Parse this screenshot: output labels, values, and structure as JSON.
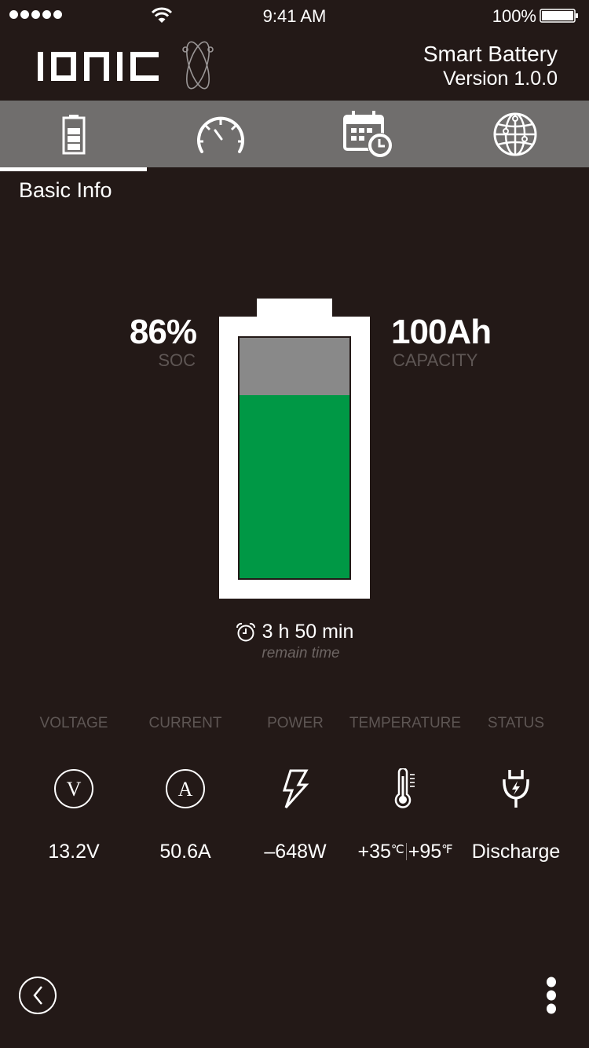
{
  "status_bar": {
    "signal_icon": "signal-dots-icon",
    "wifi_icon": "wifi-icon",
    "time": "9:41 AM",
    "battery_percent": "100%",
    "battery_icon": "battery-full-icon"
  },
  "header": {
    "logo_text": "IONIC",
    "logo_icon": "atom-orbit-icon",
    "title": "Smart Battery",
    "version": "Version 1.0.0"
  },
  "tabs": [
    {
      "id": "basic-info",
      "icon": "battery-icon",
      "active": true
    },
    {
      "id": "gauge",
      "icon": "speedometer-icon",
      "active": false
    },
    {
      "id": "schedule",
      "icon": "calendar-clock-icon",
      "active": false
    },
    {
      "id": "network",
      "icon": "globe-icon",
      "active": false
    }
  ],
  "section_title": "Basic Info",
  "battery": {
    "soc_value": "86%",
    "soc_label": "SOC",
    "capacity_value": "100Ah",
    "capacity_label": "CAPACITY",
    "fill_fraction": 0.76,
    "colors": {
      "fill": "#009845",
      "empty": "#898989",
      "shell": "#ffffff"
    }
  },
  "remaining": {
    "icon": "alarm-clock-icon",
    "value": "3 h 50 min",
    "label": "remain time"
  },
  "metrics": [
    {
      "label": "VOLTAGE",
      "icon": "voltage-icon",
      "value": "13.2V"
    },
    {
      "label": "CURRENT",
      "icon": "current-icon",
      "value": "50.6A"
    },
    {
      "label": "POWER",
      "icon": "lightning-icon",
      "value": "–648W"
    },
    {
      "label": "TEMPERATURE",
      "icon": "thermometer-icon",
      "value_c": "+35",
      "unit_c": "℃",
      "value_f": "+95",
      "unit_f": "℉"
    },
    {
      "label": "STATUS",
      "icon": "plug-charge-icon",
      "value": "Discharge"
    }
  ],
  "bottom_bar": {
    "back_icon": "back-chevron-icon",
    "more_icon": "more-vertical-icon"
  }
}
